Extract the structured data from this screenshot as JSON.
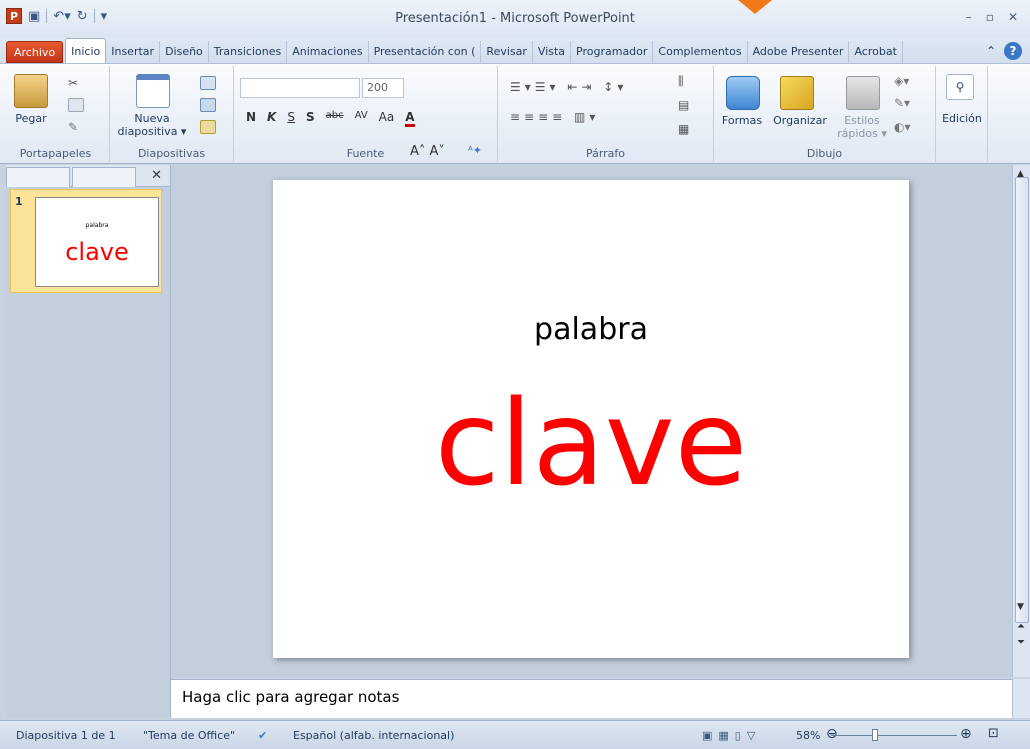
{
  "window": {
    "title": "Presentación1 - Microsoft PowerPoint",
    "app_icon": "P"
  },
  "tabs": [
    "Archivo",
    "Inicio",
    "Insertar",
    "Diseño",
    "Transiciones",
    "Animaciones",
    "Presentación con (",
    "Revisar",
    "Vista",
    "Programador",
    "Complementos",
    "Adobe Presenter",
    "Acrobat"
  ],
  "ribbon": {
    "clipboard": {
      "label": "Portapapeles",
      "paste": "Pegar"
    },
    "slides": {
      "label": "Diapositivas",
      "new_line1": "Nueva",
      "new_line2": "diapositiva ▾"
    },
    "font": {
      "label": "Fuente",
      "size": "200",
      "bold": "N",
      "italic": "K",
      "underline": "S",
      "shadow": "S",
      "strike": "abc",
      "spacing": "AV",
      "case": "Aa",
      "color": "A"
    },
    "paragraph": {
      "label": "Párrafo"
    },
    "drawing": {
      "label": "Dibujo",
      "shapes": "Formas",
      "arrange": "Organizar",
      "styles_line1": "Estilos",
      "styles_line2": "rápidos ▾"
    },
    "editing": {
      "label": "Edición"
    }
  },
  "slide": {
    "number": "1",
    "word1": "palabra",
    "word2": "clave"
  },
  "notes": {
    "placeholder": "Haga clic para agregar notas"
  },
  "status": {
    "slide": "Diapositiva 1 de 1",
    "theme": "\"Tema de Office\"",
    "lang": "Español (alfab. internacional)",
    "zoom": "58%"
  },
  "colors": {
    "accent": "#ff0000",
    "file_tab": "#d24726",
    "arrow": "#f07a1a"
  }
}
